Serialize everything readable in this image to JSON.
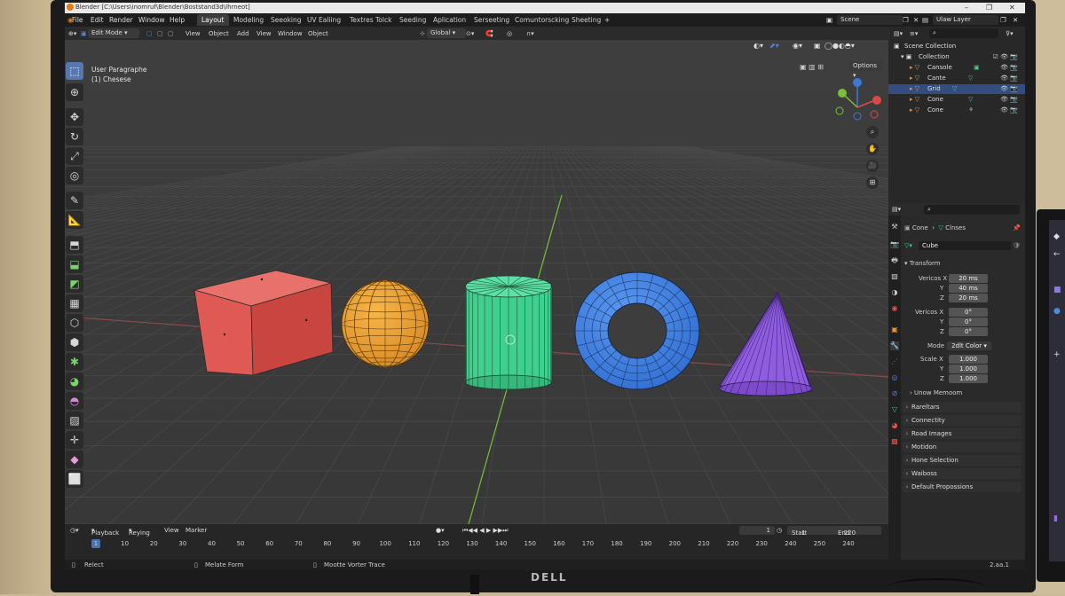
{
  "window": {
    "title": "Blender [C:\\Users\\inomruf\\Blender\\Boststand3d\\Ihrneot]"
  },
  "menu": [
    "File",
    "Edit",
    "Render",
    "Window",
    "Help"
  ],
  "workspaces": [
    {
      "label": "Layout",
      "active": true
    },
    {
      "label": "Modeling"
    },
    {
      "label": "Seeoking"
    },
    {
      "label": "UV Ealiing"
    },
    {
      "label": "Textres Tolck"
    },
    {
      "label": "Seeding"
    },
    {
      "label": "Aplication"
    },
    {
      "label": "Serseeting"
    },
    {
      "label": "Comuntorscking"
    },
    {
      "label": "Sheeting"
    }
  ],
  "scene": {
    "name": "Scene",
    "layer": "Ulaw Layer"
  },
  "header": {
    "mode": "Edit Mode",
    "menus": [
      "View",
      "Object",
      "Add",
      "View",
      "Window",
      "Object"
    ],
    "transform": "Global",
    "options": "Options"
  },
  "viewport": {
    "line1": "User Paragraphe",
    "line2": "(1) Chesese"
  },
  "outliner": {
    "title": "Scene Collection",
    "collection": "Collection",
    "items": [
      {
        "label": "Cansole",
        "icon": "cube-mesh-icon"
      },
      {
        "label": "Cante",
        "icon": "mesh-triangle-icon"
      },
      {
        "label": "Grid",
        "icon": "mesh-triangle-icon",
        "selected": true
      },
      {
        "label": "Cone",
        "icon": "mesh-triangle-icon"
      },
      {
        "label": "Cone",
        "icon": "material-icon"
      }
    ]
  },
  "properties": {
    "breadcrumb_a": "Cone",
    "breadcrumb_b": "Clnses",
    "object_name": "Cube",
    "transform_title": "Transform",
    "vertices_label": "Vericos X",
    "vertices": [
      "20 ms",
      "40 ms",
      "20 ms"
    ],
    "vertices2_label": "Vericos X",
    "vertices2": [
      "0°",
      "0°",
      "0°"
    ],
    "mode_label": "Mode",
    "mode_value": "2dlt Color",
    "scale_label": "Scale X",
    "scale": [
      "1.000",
      "1.000",
      "1.000"
    ],
    "axis_y": "Y",
    "axis_z": "Z",
    "sub_panel": "Unow Memoom",
    "panels": [
      "Rareltars",
      "Connectity",
      "Road Images",
      "Motidon",
      "Hone Selection",
      "Waiboss",
      "Default Propossions"
    ]
  },
  "timeline": {
    "menus": [
      "Playback",
      "Reying",
      "View",
      "Marker"
    ],
    "current_frame": "1",
    "start_label": "Start",
    "start": "1",
    "end_label": "End",
    "end": "220",
    "ticks": [
      "1",
      "10",
      "20",
      "30",
      "40",
      "50",
      "60",
      "70",
      "80",
      "90",
      "100",
      "110",
      "120",
      "130",
      "140",
      "150",
      "160",
      "170",
      "180",
      "190",
      "200",
      "210",
      "220",
      "230",
      "240",
      "250",
      "240"
    ]
  },
  "status": {
    "left": "Relect",
    "mid": "Melate Form",
    "right": "Mootte Vorter Trace",
    "version": "2.aa.1"
  },
  "colors": {
    "accent": "#4772b3",
    "cube": "#e05a55",
    "sphere": "#f2a43a",
    "cylinder": "#3fcf8e",
    "torus": "#3d7fe6",
    "cone": "#8f5de0"
  }
}
